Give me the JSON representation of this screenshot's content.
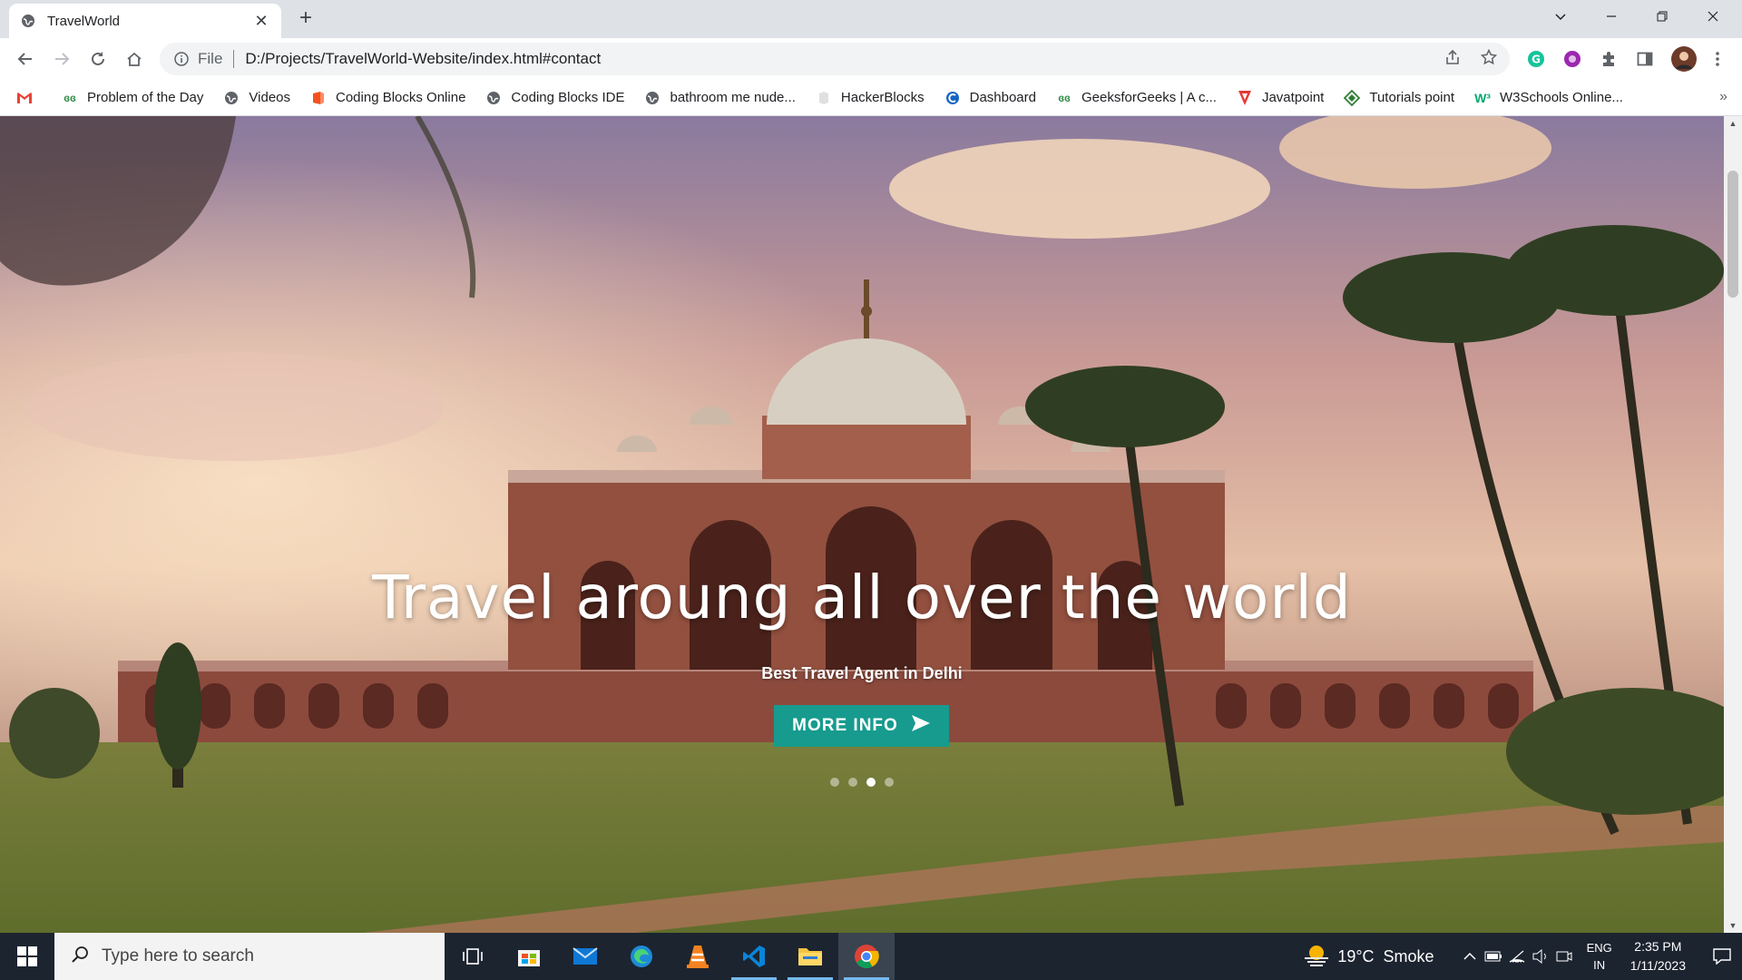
{
  "browser": {
    "tab": {
      "title": "TravelWorld",
      "favicon": "globe-icon",
      "close": "✕"
    },
    "new_tab": "+",
    "window_controls": [
      "chevron-down-icon",
      "minimize-icon",
      "restore-icon",
      "close-icon"
    ],
    "address": {
      "scheme_label": "File",
      "url": "D:/Projects/TravelWorld-Website/index.html#contact"
    },
    "bookmarks": [
      {
        "label": "Problem of the Day",
        "icon": "gfg-icon",
        "color": "#2f8d46"
      },
      {
        "label": "Videos",
        "icon": "globe-icon",
        "color": "#5f6368"
      },
      {
        "label": "Coding Blocks Online",
        "icon": "codingblocks-icon",
        "color": "#f4511e"
      },
      {
        "label": "Coding Blocks IDE",
        "icon": "globe-icon",
        "color": "#5f6368"
      },
      {
        "label": "bathroom me nude...",
        "icon": "globe-icon",
        "color": "#5f6368"
      },
      {
        "label": "HackerBlocks",
        "icon": "hackerblocks-icon",
        "color": "#c0c0c0"
      },
      {
        "label": "Dashboard",
        "icon": "dashboard-icon",
        "color": "#1565c0"
      },
      {
        "label": "GeeksforGeeks | A c...",
        "icon": "gfg-icon",
        "color": "#2f8d46"
      },
      {
        "label": "Javatpoint",
        "icon": "javatpoint-icon",
        "color": "#e53935"
      },
      {
        "label": "Tutorials point",
        "icon": "tutorialspoint-icon",
        "color": "#2e7d32"
      },
      {
        "label": "W3Schools Online...",
        "icon": "w3schools-icon",
        "color": "#04aa6d"
      }
    ],
    "bookmarks_overflow": "»"
  },
  "hero": {
    "title": "Travel aroung all over the world",
    "subtitle": "Best Travel Agent in Delhi",
    "button_label": "MORE INFO",
    "accent_color": "#169b8e",
    "slides": 4,
    "active_slide": 3
  },
  "taskbar": {
    "search_placeholder": "Type here to search",
    "weather": "19°C  Smoke",
    "lang_top": "ENG",
    "lang_bottom": "IN",
    "time": "2:35 PM",
    "date": "1/11/2023",
    "apps": [
      "task-view-icon",
      "store-icon",
      "mail-icon",
      "edge-icon",
      "vlc-icon",
      "vscode-icon",
      "file-explorer-icon",
      "chrome-icon"
    ]
  }
}
